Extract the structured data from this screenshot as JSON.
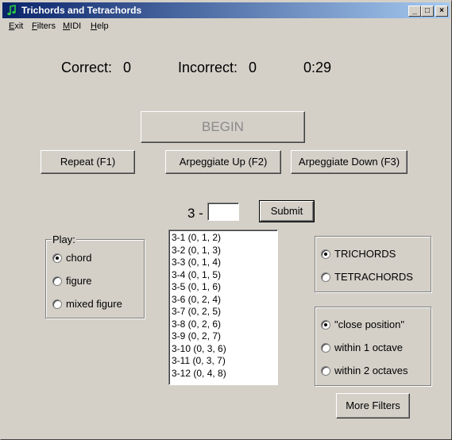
{
  "window": {
    "title": "Trichords and Tetrachords"
  },
  "titlebar_buttons": {
    "minimize": "_",
    "maximize": "□",
    "close": "×"
  },
  "menu": [
    {
      "label": "Exit",
      "accel": "E",
      "rest": "xit"
    },
    {
      "label": "Filters",
      "accel": "F",
      "rest": "ilters"
    },
    {
      "label": "MIDI",
      "accel": "M",
      "rest": "IDI"
    },
    {
      "label": "Help",
      "accel": "H",
      "rest": "elp"
    }
  ],
  "score": {
    "correct_label": "Correct:",
    "correct_value": "0",
    "incorrect_label": "Incorrect:",
    "incorrect_value": "0",
    "timer": "0:29"
  },
  "buttons": {
    "begin": "BEGIN",
    "repeat": "Repeat (F1)",
    "arpeggiate_up": "Arpeggiate Up (F2)",
    "arpeggiate_down": "Arpeggiate Down (F3)",
    "submit": "Submit",
    "more_filters": "More Filters"
  },
  "answer": {
    "prefix": "3 -",
    "value": ""
  },
  "play_group": {
    "legend": "Play:",
    "options": [
      {
        "label": "chord",
        "selected": true
      },
      {
        "label": "figure",
        "selected": false
      },
      {
        "label": "mixed figure",
        "selected": false
      }
    ]
  },
  "set_list": [
    "3-1 (0, 1, 2)",
    "3-2 (0, 1, 3)",
    "3-3 (0, 1, 4)",
    "3-4 (0, 1, 5)",
    "3-5 (0, 1, 6)",
    "3-6 (0, 2, 4)",
    "3-7 (0, 2, 5)",
    "3-8 (0, 2, 6)",
    "3-9 (0, 2, 7)",
    "3-10 (0, 3, 6)",
    "3-11 (0, 3, 7)",
    "3-12 (0, 4, 8)"
  ],
  "chord_type_group": {
    "options": [
      {
        "label": "TRICHORDS",
        "selected": true
      },
      {
        "label": "TETRACHORDS",
        "selected": false
      }
    ]
  },
  "voicing_group": {
    "options": [
      {
        "label": "\"close position\"",
        "selected": true
      },
      {
        "label": "within 1 octave",
        "selected": false
      },
      {
        "label": "within 2 octaves",
        "selected": false
      }
    ]
  },
  "colors": {
    "face": "#d4d0c8",
    "title_start": "#0a246a",
    "title_end": "#a6caf0",
    "disabled_text": "#8a8a8a"
  }
}
